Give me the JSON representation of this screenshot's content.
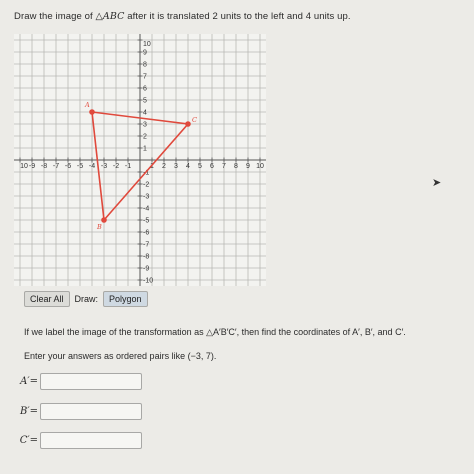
{
  "question": {
    "prefix": "Draw the image of ",
    "triangle": "△ABC",
    "suffix": " after it is translated 2 units to the left and 4 units up."
  },
  "graph": {
    "xmin": -10,
    "xmax": 10,
    "ymin": -10,
    "ymax": 10,
    "x_ticks": [
      "10",
      "-9",
      "-8",
      "-7",
      "-6",
      "-5",
      "-4",
      "-3",
      "-2",
      "-1",
      "1",
      "2",
      "3",
      "4",
      "5",
      "6",
      "7",
      "8",
      "9",
      "10"
    ],
    "y_ticks": [
      "10",
      "9",
      "8",
      "7",
      "6",
      "5",
      "4",
      "3",
      "2",
      "1",
      "-1",
      "-2",
      "-3",
      "-4",
      "-5",
      "-6",
      "-7",
      "-8",
      "-9",
      "-10"
    ],
    "polygon_color": "#e0493c",
    "points": [
      {
        "label": "A",
        "x": -4,
        "y": 4
      },
      {
        "label": "C",
        "x": 4,
        "y": 3
      },
      {
        "label": "B",
        "x": -3,
        "y": -5
      }
    ]
  },
  "controls": {
    "clear_all": "Clear All",
    "draw_label": "Draw:",
    "polygon": "Polygon"
  },
  "prompt1": "If we label the image of the transformation as △A′B′C′, then find the coordinates of A′, B′, and C′.",
  "prompt2": "Enter your answers as ordered pairs like (−3, 7).",
  "answers": [
    {
      "label": "A′=",
      "value": ""
    },
    {
      "label": "B′=",
      "value": ""
    },
    {
      "label": "C′=",
      "value": ""
    }
  ]
}
